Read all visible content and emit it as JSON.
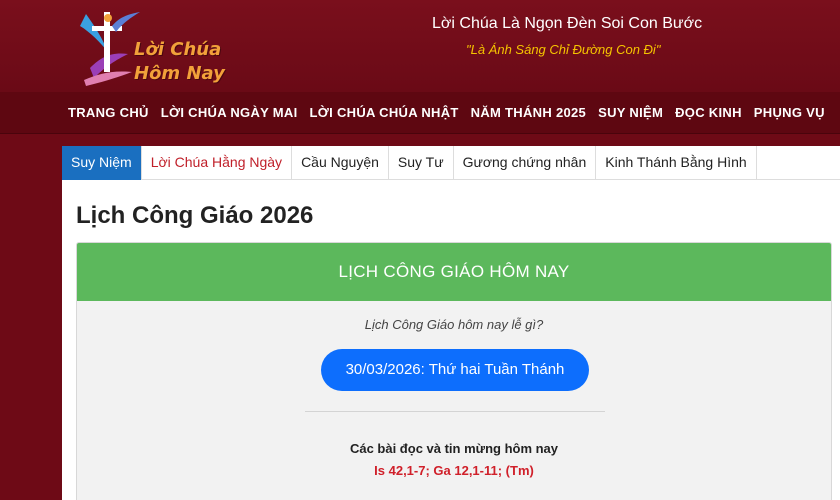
{
  "header": {
    "logo_lines": [
      "Lời Chúa",
      "Hôm Nay"
    ],
    "tagline_main": "Lời Chúa Là Ngọn Đèn Soi Con Bước",
    "tagline_sub": "\"Là Ánh Sáng Chỉ Đường Con Đi\""
  },
  "main_nav": [
    {
      "label": "TRANG CHỦ"
    },
    {
      "label": "LỜI CHÚA NGÀY MAI"
    },
    {
      "label": "LỜI CHÚA CHÚA NHẬT"
    },
    {
      "label": "NĂM THÁNH 2025"
    },
    {
      "label": "SUY NIỆM"
    },
    {
      "label": "ĐỌC KINH"
    },
    {
      "label": "PHỤNG VỤ"
    }
  ],
  "sub_tabs": [
    {
      "label": "Suy Niệm",
      "state": "active"
    },
    {
      "label": "Lời Chúa Hằng Ngày",
      "state": "highlight"
    },
    {
      "label": "Cầu Nguyện",
      "state": "normal"
    },
    {
      "label": "Suy Tư",
      "state": "normal"
    },
    {
      "label": "Gương chứng nhân",
      "state": "normal"
    },
    {
      "label": "Kinh Thánh Bằng Hình",
      "state": "normal"
    }
  ],
  "page_title": "Lịch Công Giáo 2026",
  "card": {
    "heading": "LỊCH CÔNG GIÁO HÔM NAY",
    "question": "Lịch Công Giáo hôm nay lễ gì?",
    "date_button": "30/03/2026: Thứ hai Tuần Thánh",
    "readings_title": "Các bài đọc và tin mừng hôm nay",
    "readings_refs": "Is 42,1-7; Ga 12,1-11; (Tm)"
  },
  "colors": {
    "brand_maroon": "#6e0a16",
    "accent_gold": "#f5c400",
    "header_green": "#5cb85c",
    "button_blue": "#0d6efd",
    "tab_active_blue": "#1a6fc0",
    "reference_red": "#d0202a"
  },
  "icons": {
    "logo": "cross-with-figure-logo"
  }
}
